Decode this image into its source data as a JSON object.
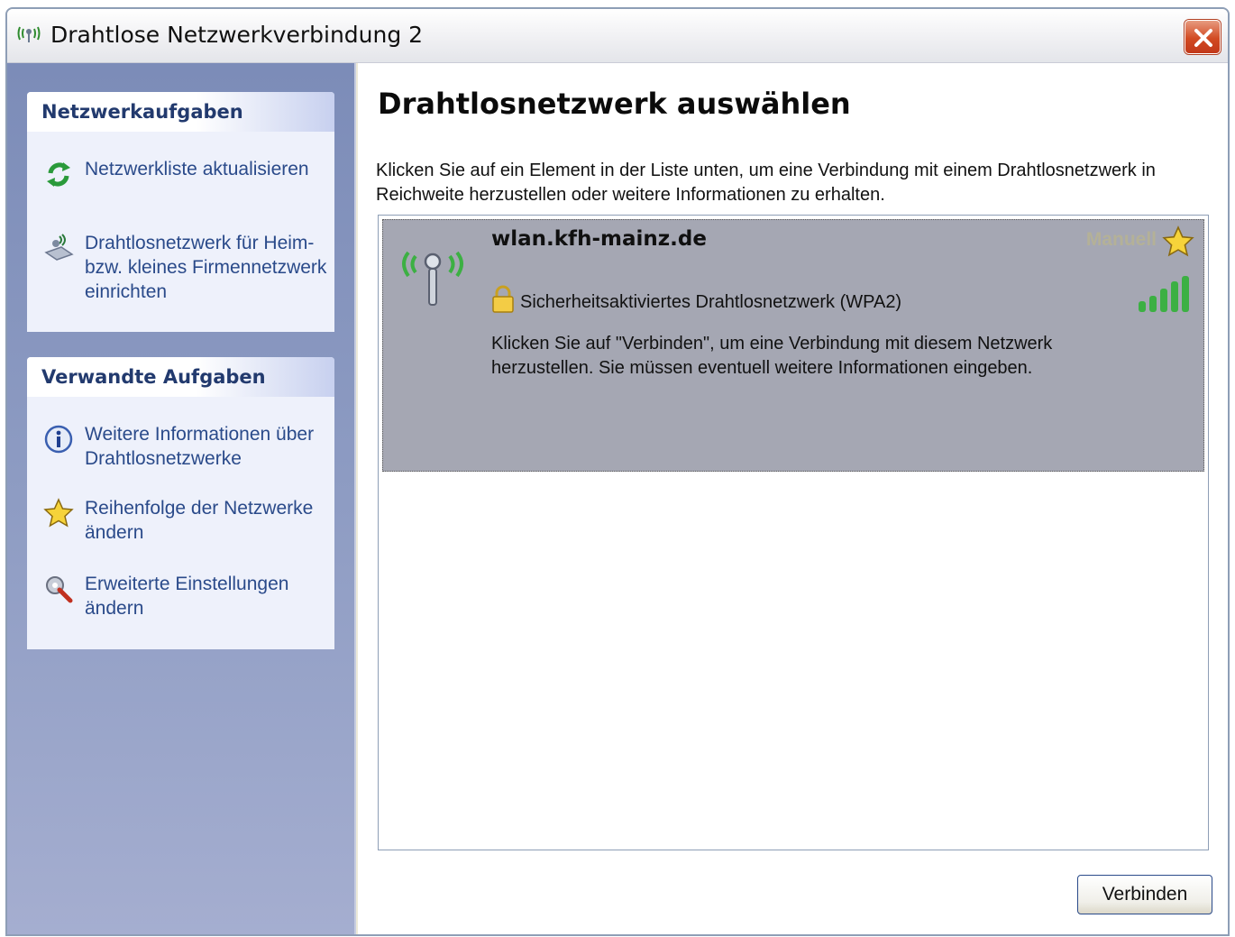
{
  "window": {
    "title": "Drahtlose Netzwerkverbindung 2",
    "close_label": "×"
  },
  "sidebar": {
    "panels": [
      {
        "title": "Netzwerkaufgaben",
        "items": [
          {
            "icon": "refresh-icon",
            "label": "Netzwerkliste aktualisieren"
          },
          {
            "icon": "wireless-setup-icon",
            "label": "Drahtlosnetzwerk für Heim- bzw. kleines Firmennetzwerk einrichten"
          }
        ]
      },
      {
        "title": "Verwandte Aufgaben",
        "items": [
          {
            "icon": "info-icon",
            "label": "Weitere Informationen über Drahtlosnetzwerke"
          },
          {
            "icon": "star-icon",
            "label": "Reihenfolge der Netzwerke ändern"
          },
          {
            "icon": "settings-icon",
            "label": "Erweiterte Einstellungen ändern"
          }
        ]
      }
    ]
  },
  "main": {
    "heading": "Drahtlosnetzwerk auswählen",
    "intro": "Klicken Sie auf ein Element in der Liste unten, um eine Verbindung mit einem Drahtlosnetzwerk in Reichweite herzustellen oder weitere Informationen zu erhalten.",
    "networks": [
      {
        "ssid": "wlan.kfh-mainz.de",
        "mode": "Manuell",
        "security": "Sicherheitsaktiviertes Drahtlosnetzwerk (WPA2)",
        "description": "Klicken Sie auf \"Verbinden\", um eine Verbindung mit diesem Netzwerk herzustellen. Sie müssen eventuell weitere Informationen eingeben.",
        "signal_bars": 5
      }
    ],
    "connect_label": "Verbinden"
  },
  "colors": {
    "sidebar_gradient_top": "#7c8cb8",
    "panel_title": "#223a6e",
    "task_link": "#2a4a8a",
    "selected_item": "#a5a7b3",
    "signal_green": "#3cb043",
    "close_red": "#d24a22"
  }
}
